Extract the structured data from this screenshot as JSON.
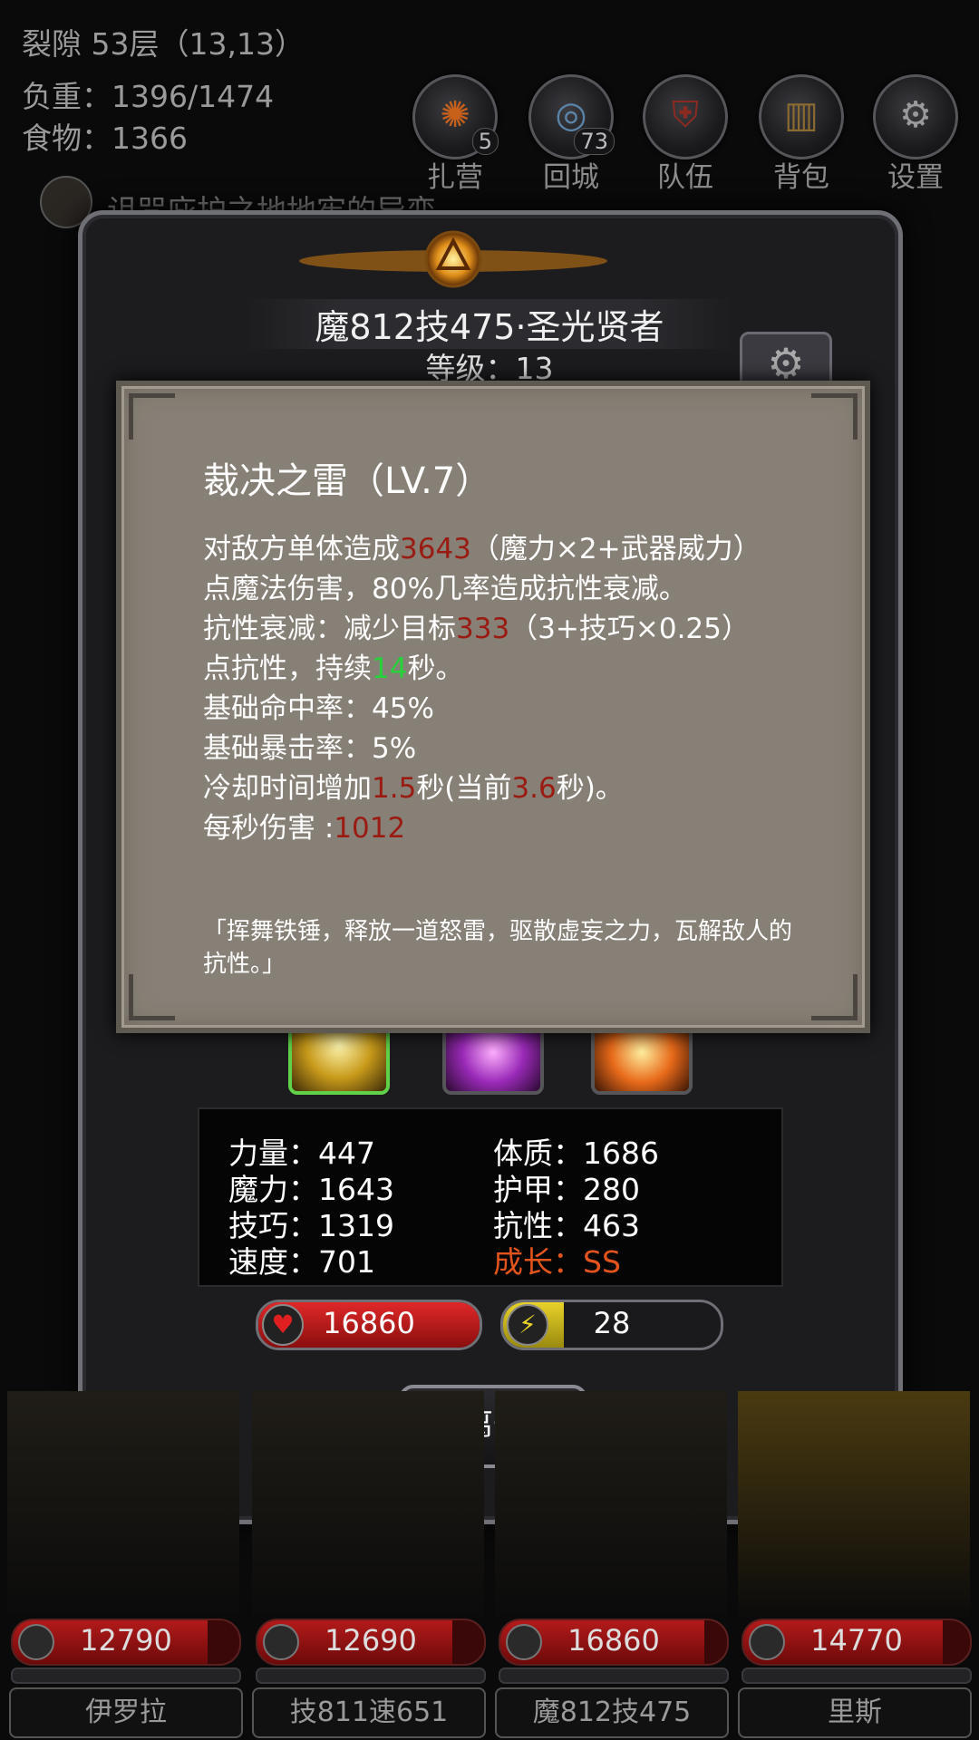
{
  "hud": {
    "location": "裂隙 53层（13,13）",
    "weight": "负重：1396/1474",
    "food": "食物：1366",
    "quest": "诅咒庇护之地地牢的异变"
  },
  "menu": [
    {
      "label": "扎营",
      "icon": "camp-icon",
      "badge": "5"
    },
    {
      "label": "回城",
      "icon": "portal-icon",
      "badge": "73"
    },
    {
      "label": "队伍",
      "icon": "team-icon",
      "badge": ""
    },
    {
      "label": "背包",
      "icon": "backpack-icon",
      "badge": ""
    },
    {
      "label": "设置",
      "icon": "settings-icon",
      "badge": ""
    }
  ],
  "hero": {
    "title": "魔812技475·圣光贤者",
    "level": "等级：13"
  },
  "skill_popup": {
    "title": "裁决之雷（LV.7）",
    "line1_a": "对敌方单体造成",
    "line1_dmg": "3643",
    "line1_b": "（魔力×2+武器威力）",
    "line2": "点魔法伤害，80%几率造成抗性衰减。",
    "line3_a": "抗性衰减：减少目标",
    "line3_val": "333",
    "line3_b": "（3+技巧×0.25）",
    "line4_a": "点抗性，持续",
    "line4_dur": "14",
    "line4_b": "秒。",
    "line5": "基础命中率：45%",
    "line6": "基础暴击率：5%",
    "line7_a": "冷却时间增加",
    "line7_v1": "1.5",
    "line7_b": "秒(当前",
    "line7_v2": "3.6",
    "line7_c": "秒)。",
    "line8_a": "每秒伤害 :",
    "line8_val": "1012",
    "quote": "「挥舞铁锤，释放一道怒雷，驱散虚妄之力，瓦解敌人的抗性。」"
  },
  "stats": {
    "str": "力量：447",
    "con": "体质：1686",
    "mag": "魔力：1643",
    "arm": "护甲：280",
    "tec": "技巧：1319",
    "res": "抗性：463",
    "spd": "速度：701",
    "growth": "成长：SS"
  },
  "bars": {
    "hp": "16860",
    "hp_fill": 1.0,
    "energy": "28",
    "energy_fill": 0.28
  },
  "leave_label": "离开",
  "party": [
    {
      "hp": "12790",
      "name": "伊罗拉"
    },
    {
      "hp": "12690",
      "name": "技811速651"
    },
    {
      "hp": "16860",
      "name": "魔812技475"
    },
    {
      "hp": "14770",
      "name": "里斯"
    }
  ],
  "colors": {
    "damage_red": "#9a1b12",
    "duration_green": "#26d13a",
    "growth_orange": "#e2541c",
    "hp_red": "#c01818",
    "energy_yellow": "#d8c21c"
  }
}
